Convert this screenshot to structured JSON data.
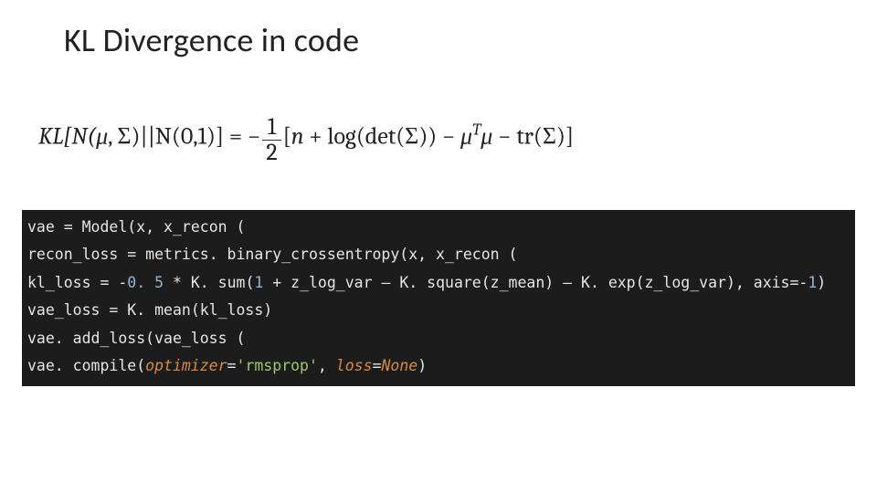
{
  "title": "KL Divergence in code",
  "formula": {
    "lhs_open": "KL[N(",
    "mu": "μ",
    "comma": ", ",
    "Sigma": "Σ",
    "lhs_mid": ")||N(0,1)] = ",
    "neg": "−",
    "frac_num": "1",
    "frac_den": "2",
    "bracket_open": "[",
    "n": "n",
    "plus1": " + log(det(",
    "Sigma2": "Σ",
    "after_det": ")) − ",
    "mu2": "μ",
    "T": "T",
    "mu3": "μ",
    "minus_tr": " − tr(",
    "Sigma3": "Σ",
    "bracket_close": ")]"
  },
  "code": {
    "l1": {
      "a": "vae ",
      "eq": "=",
      "b": " Model(x, x_recon ("
    },
    "l2": {
      "a": "recon_loss ",
      "eq": "=",
      "b": " metrics. binary_crossentropy(x, x_recon ("
    },
    "l3": {
      "a": "kl_loss ",
      "eq": "=",
      "neg": " -",
      "num1": "0. 5",
      "b": " * K. sum(",
      "num2": "1",
      "c": " + z_log_var – K. square(z_mean) – K. exp(z_log_var), axis=-",
      "num3": "1",
      "d": ")"
    },
    "l4": {
      "a": "vae_loss ",
      "eq": "=",
      "b": " K. mean(kl_loss)"
    },
    "l5": {
      "a": "vae. add_loss(vae_loss ("
    },
    "l6": {
      "a": "vae. compile(",
      "kw1": "optimizer",
      "eq1": "=",
      "str1": "'rmsprop'",
      "comma": ", ",
      "kw2": "loss",
      "eq2": "=",
      "none": "None",
      "close": ")"
    }
  }
}
